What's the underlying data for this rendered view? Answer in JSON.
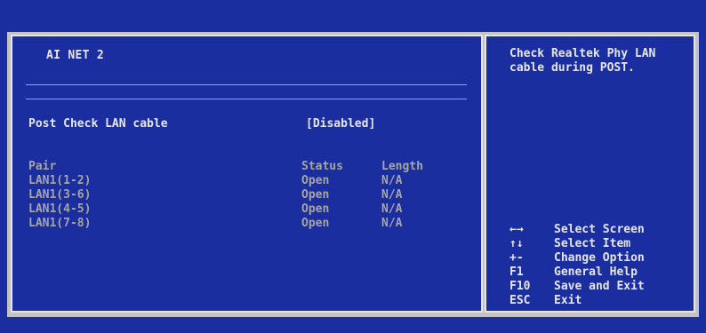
{
  "bios": {
    "title": "AI NET 2",
    "setting": {
      "label": "Post Check LAN cable",
      "value": "[Disabled]"
    },
    "table": {
      "headers": [
        "Pair",
        "Status",
        "Length"
      ],
      "rows": [
        {
          "pair": "LAN1(1-2)",
          "status": "Open",
          "length": "N/A"
        },
        {
          "pair": "LAN1(3-6)",
          "status": "Open",
          "length": "N/A"
        },
        {
          "pair": "LAN1(4-5)",
          "status": "Open",
          "length": "N/A"
        },
        {
          "pair": "LAN1(7-8)",
          "status": "Open",
          "length": "N/A"
        }
      ]
    }
  },
  "help": {
    "text": "Check Realtek Phy LAN cable during POST."
  },
  "keys": [
    {
      "key": "←→",
      "desc": "Select Screen",
      "icon": "left-right-arrows-icon"
    },
    {
      "key": "↑↓",
      "desc": "Select Item",
      "icon": "up-down-arrows-icon"
    },
    {
      "key": "+-",
      "desc": "Change Option"
    },
    {
      "key": "F1",
      "desc": "General Help"
    },
    {
      "key": "F10",
      "desc": "Save and Exit"
    },
    {
      "key": "ESC",
      "desc": "Exit"
    }
  ],
  "colors": {
    "background": "#1a2ea0",
    "frame": "#c3c3c3",
    "text": "#e6e6e6",
    "dim_text": "#a5a5a5",
    "rule": "#6fb8ee"
  }
}
